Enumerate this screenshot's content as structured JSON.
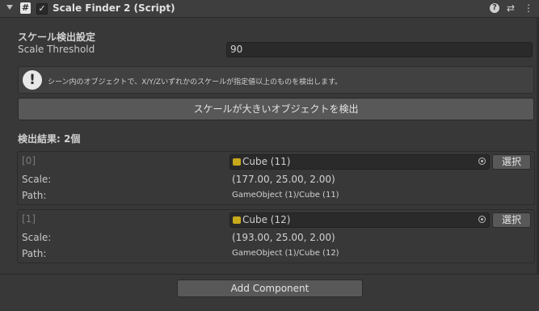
{
  "header": {
    "title": "Scale Finder 2 (Script)",
    "script_icon": "#",
    "enabled_check": "✓",
    "help_icon": "?",
    "settings_icon": "⇄",
    "menu_icon": "⋮"
  },
  "settings": {
    "section_title": "スケール検出設定",
    "threshold_label": "Scale Threshold",
    "threshold_value": "90"
  },
  "helpbox": {
    "icon": "!",
    "message": "シーン内のオブジェクトで、X/Y/Zいずれかのスケールが指定値以上のものを検出します。"
  },
  "detect_button": "スケールが大きいオブジェクトを検出",
  "results": {
    "title": "検出結果: 2個",
    "items": [
      {
        "index": "[0]",
        "object": "Cube (11)",
        "select_label": "選択",
        "scale_label": "Scale:",
        "scale_value": "(177.00, 25.00, 2.00)",
        "path_label": "Path:",
        "path_value": "GameObject (1)/Cube (11)"
      },
      {
        "index": "[1]",
        "object": "Cube (12)",
        "select_label": "選択",
        "scale_label": "Scale:",
        "scale_value": "(193.00, 25.00, 2.00)",
        "path_label": "Path:",
        "path_value": "GameObject (1)/Cube (12)"
      }
    ]
  },
  "add_component": "Add Component"
}
